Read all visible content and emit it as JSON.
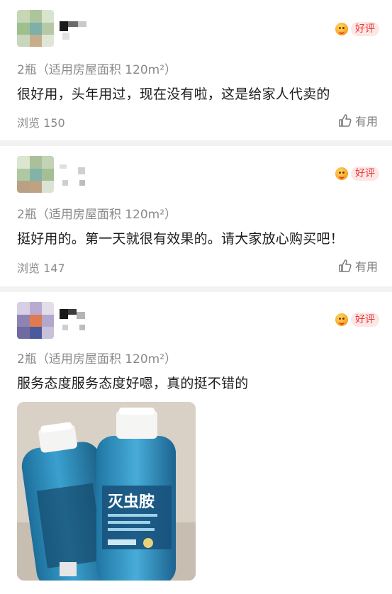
{
  "reviews": [
    {
      "badge_label": "好评",
      "spec": "2瓶（适用房屋面积 120m²）",
      "content": "很好用，头年用过，现在没有啦，这是给家人代卖的",
      "views": "浏览 150",
      "helpful_label": "有用"
    },
    {
      "badge_label": "好评",
      "spec": "2瓶（适用房屋面积 120m²）",
      "content": "挺好用的。第一天就很有效果的。请大家放心购买吧！",
      "views": "浏览 147",
      "helpful_label": "有用"
    },
    {
      "badge_label": "好评",
      "spec": "2瓶（适用房屋面积 120m²）",
      "content": "服务态度服务态度好嗯，真的挺不错的"
    }
  ],
  "photo": {
    "bottle_label": "灭虫胺",
    "icon": "product-photo"
  },
  "colors": {
    "badge_text": "#e4393c",
    "badge_bg": "#fde6e4",
    "secondary_text": "#8a8a8a",
    "separator": "#f2f2f2",
    "bottle_liquid": "#2a86b8"
  }
}
